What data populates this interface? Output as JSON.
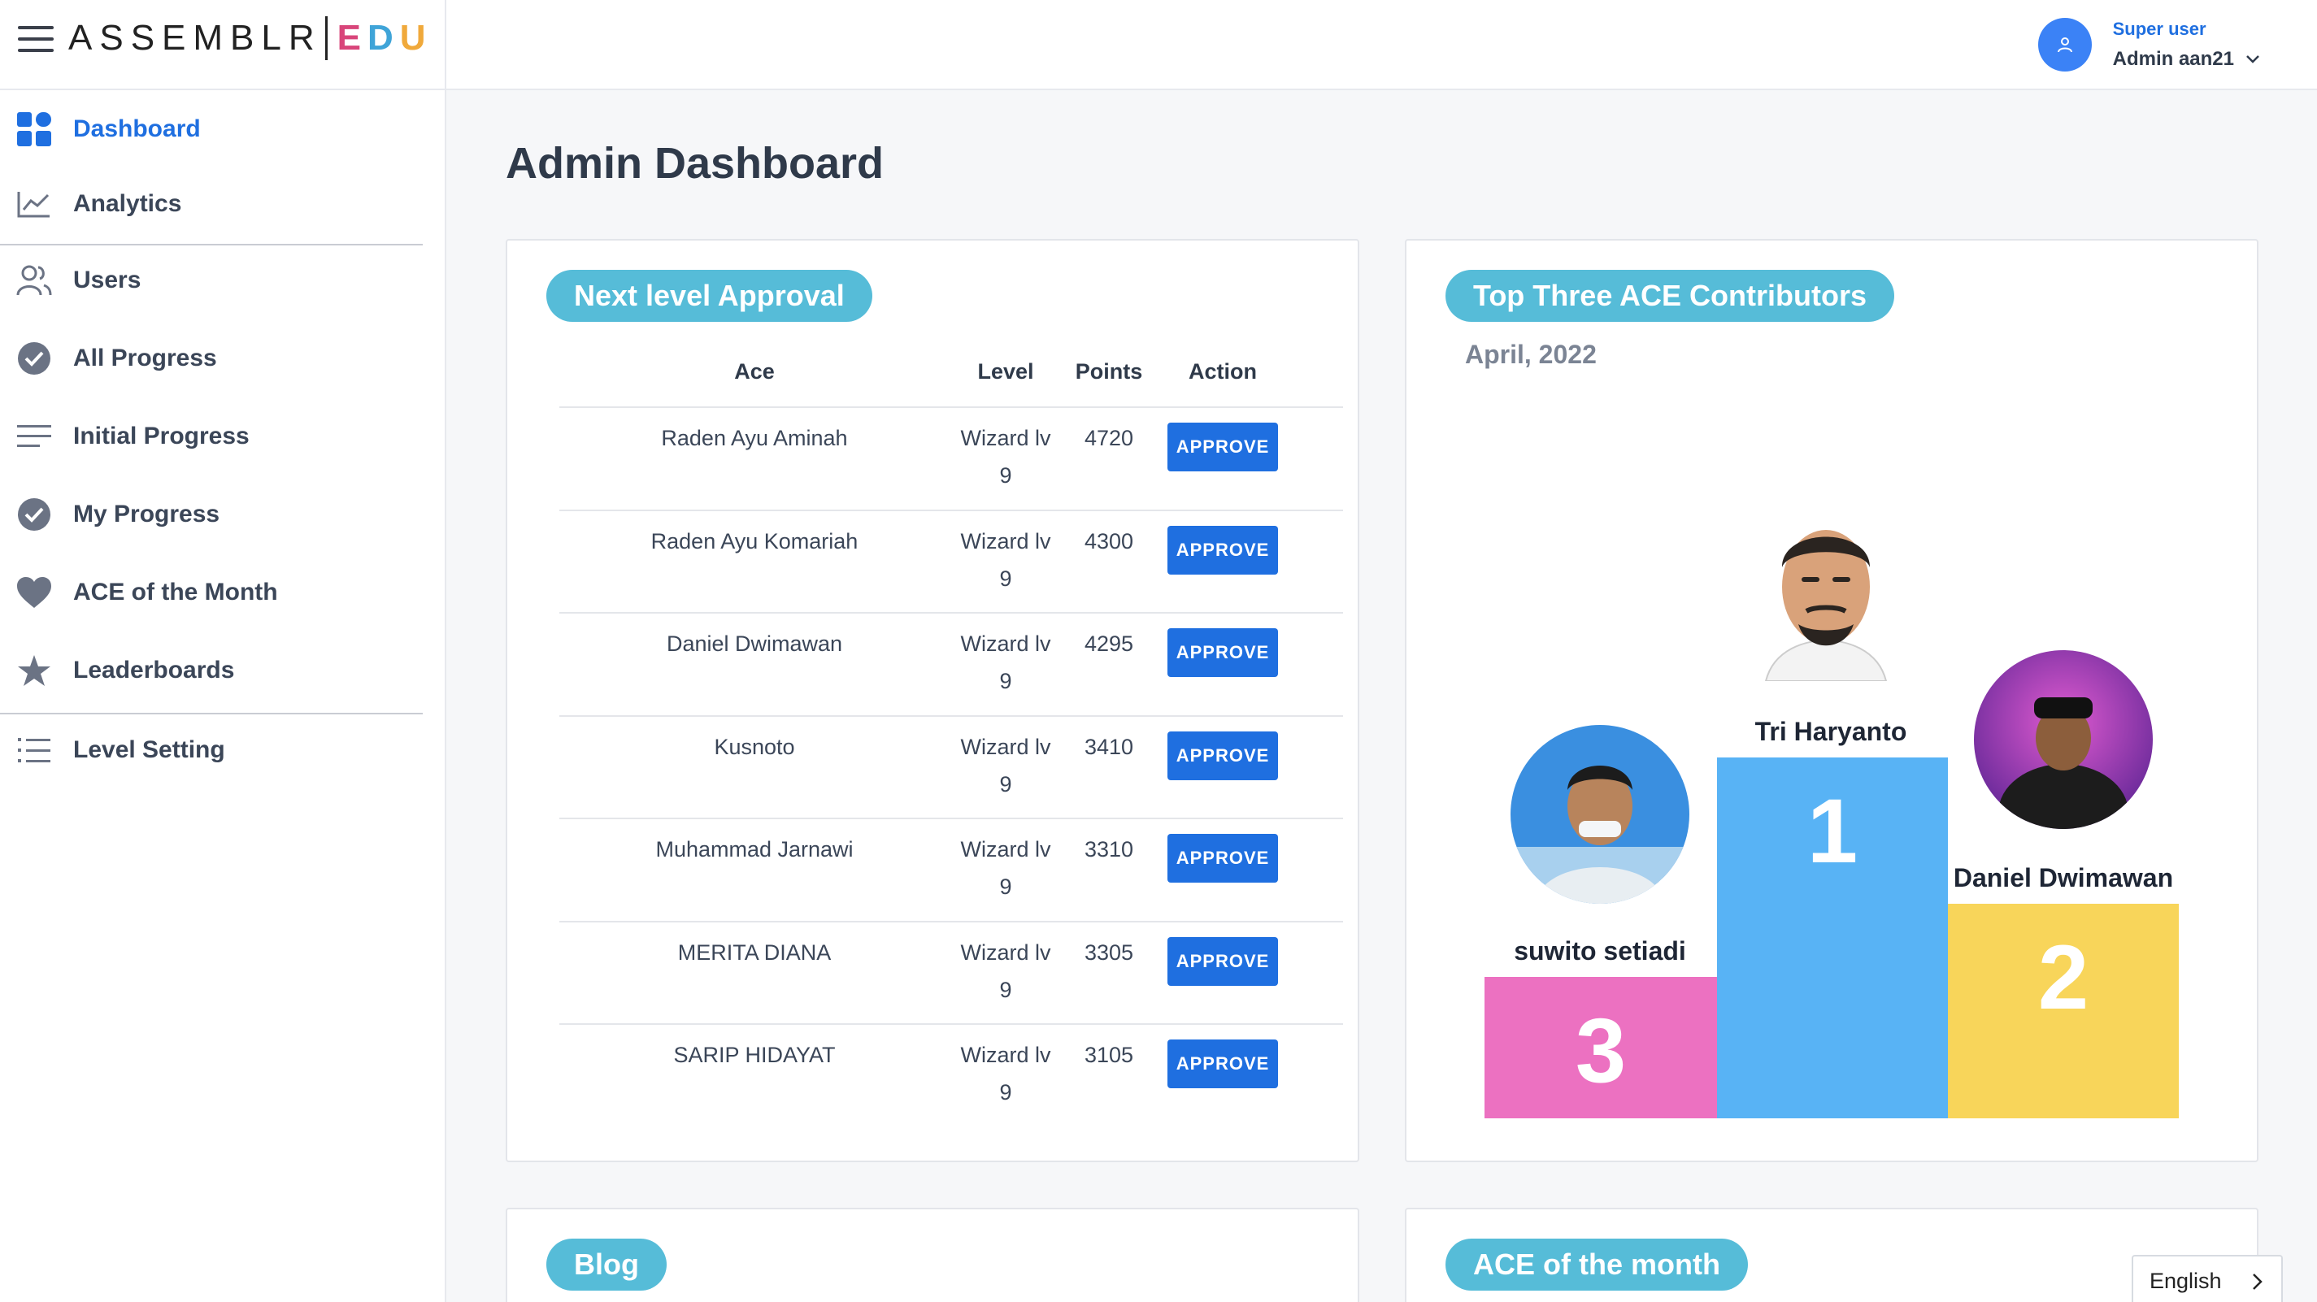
{
  "brand": {
    "logo_main": "ASSEMBLR",
    "logo_e": "E",
    "logo_d": "D",
    "logo_u": "U"
  },
  "user": {
    "role": "Super user",
    "name": "Admin aan21"
  },
  "nav": {
    "items": [
      {
        "label": "Dashboard"
      },
      {
        "label": "Analytics"
      },
      {
        "label": "Users"
      },
      {
        "label": "All Progress"
      },
      {
        "label": "Initial Progress"
      },
      {
        "label": "My Progress"
      },
      {
        "label": "ACE of the Month"
      },
      {
        "label": "Leaderboards"
      },
      {
        "label": "Level Setting"
      }
    ]
  },
  "page": {
    "title": "Admin Dashboard"
  },
  "approval": {
    "title": "Next level Approval",
    "headers": {
      "ace": "Ace",
      "level": "Level",
      "points": "Points",
      "action": "Action"
    },
    "button_label": "APPROVE",
    "rows": [
      {
        "name": "Raden Ayu Aminah",
        "level": "Wizard lv",
        "level_num": "9",
        "points": "4720"
      },
      {
        "name": "Raden Ayu Komariah",
        "level": "Wizard lv",
        "level_num": "9",
        "points": "4300"
      },
      {
        "name": "Daniel Dwimawan",
        "level": "Wizard lv",
        "level_num": "9",
        "points": "4295"
      },
      {
        "name": "Kusnoto",
        "level": "Wizard lv",
        "level_num": "9",
        "points": "3410"
      },
      {
        "name": "Muhammad Jarnawi",
        "level": "Wizard lv",
        "level_num": "9",
        "points": "3310"
      },
      {
        "name": "MERITA DIANA",
        "level": "Wizard lv",
        "level_num": "9",
        "points": "3305"
      },
      {
        "name": "SARIP HIDAYAT",
        "level": "Wizard lv",
        "level_num": "9",
        "points": "3105"
      }
    ]
  },
  "contributors": {
    "title": "Top Three ACE Contributors",
    "month": "April, 2022",
    "first": {
      "name": "Tri Haryanto",
      "rank": "1",
      "color": "#58b3f5"
    },
    "second": {
      "name": "Daniel Dwimawan",
      "rank": "2",
      "color": "#f8d55a"
    },
    "third": {
      "name": "suwito setiadi",
      "rank": "3",
      "color": "#ec71c1"
    }
  },
  "blog": {
    "title": "Blog"
  },
  "ace_month": {
    "title": "ACE of the month"
  },
  "language": {
    "selected": "English"
  }
}
